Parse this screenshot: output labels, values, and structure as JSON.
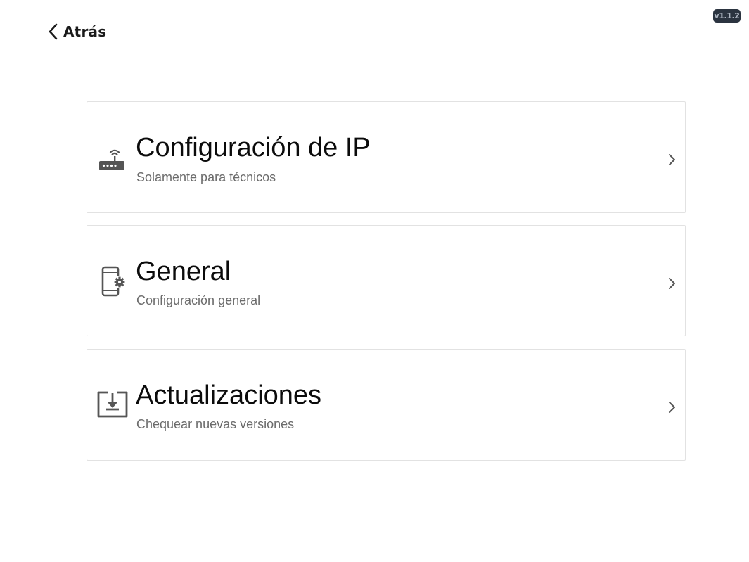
{
  "header": {
    "back_label": "Atrás",
    "back_icon": "chevron-left-icon",
    "version": "v1.1.2"
  },
  "menu": {
    "items": [
      {
        "title": "Configuración de IP",
        "subtitle": "Solamente para técnicos",
        "icon": "router-wifi-icon"
      },
      {
        "title": "General",
        "subtitle": "Configuración general",
        "icon": "phone-settings-icon"
      },
      {
        "title": "Actualizaciones",
        "subtitle": "Chequear nuevas versiones",
        "icon": "download-tray-icon"
      }
    ]
  },
  "colors": {
    "icon": "#555555",
    "subtitle": "#6b6b6b",
    "card_border": "#e2e2e2",
    "badge_bg": "#2b3440",
    "badge_text": "#aeb6c2"
  }
}
